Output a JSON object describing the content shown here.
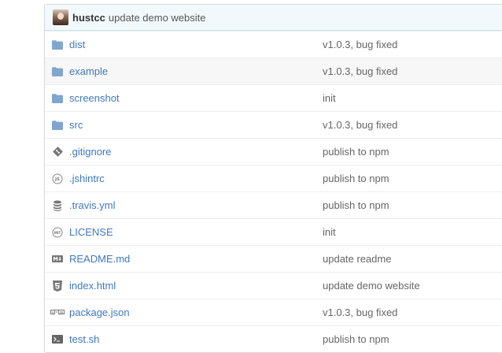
{
  "commit": {
    "author": "hustcc",
    "message": "update demo website"
  },
  "files": [
    {
      "name": "dist",
      "message": "v1.0.3, bug fixed",
      "icon": "folder-icon"
    },
    {
      "name": "example",
      "message": "v1.0.3, bug fixed",
      "icon": "folder-icon"
    },
    {
      "name": "screenshot",
      "message": "init",
      "icon": "folder-icon"
    },
    {
      "name": "src",
      "message": "v1.0.3, bug fixed",
      "icon": "folder-icon"
    },
    {
      "name": ".gitignore",
      "message": "publish to npm",
      "icon": "git-icon"
    },
    {
      "name": ".jshintrc",
      "message": "publish to npm",
      "icon": "js-icon"
    },
    {
      "name": ".travis.yml",
      "message": "publish to npm",
      "icon": "database-icon"
    },
    {
      "name": "LICENSE",
      "message": "init",
      "icon": "mit-license-icon"
    },
    {
      "name": "README.md",
      "message": "update readme",
      "icon": "markdown-icon"
    },
    {
      "name": "index.html",
      "message": "update demo website",
      "icon": "html5-icon"
    },
    {
      "name": "package.json",
      "message": "v1.0.3, bug fixed",
      "icon": "npm-icon"
    },
    {
      "name": "test.sh",
      "message": "publish to npm",
      "icon": "terminal-icon"
    }
  ],
  "colors": {
    "link": "#4078c0",
    "folder": "#80a6cd",
    "icon": "#777777"
  }
}
